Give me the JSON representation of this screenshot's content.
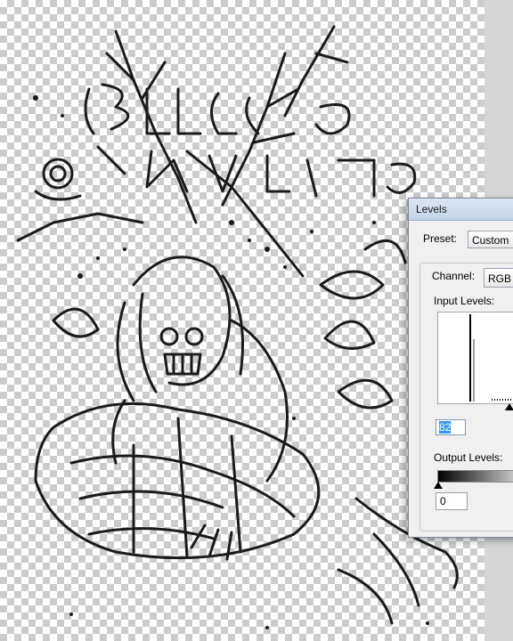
{
  "dialog": {
    "title": "Levels",
    "preset_label": "Preset:",
    "preset_value": "Custom",
    "channel_label": "Channel:",
    "channel_value": "RGB",
    "input_levels_label": "Input Levels:",
    "input_black_value": "82",
    "output_levels_label": "Output Levels:",
    "output_black_value": "0"
  },
  "colors": {
    "checker_light": "#ffffff",
    "checker_dark": "#cccccc",
    "ink": "#1a1a1a",
    "selection": "#3399ff"
  },
  "icons": [
    "dropdown-arrow-icon",
    "black-point-slider-icon",
    "white-point-slider-icon"
  ]
}
